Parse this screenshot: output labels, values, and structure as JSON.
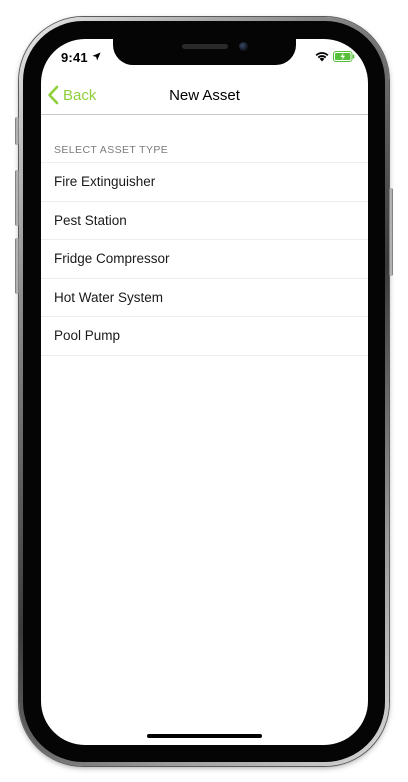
{
  "status_bar": {
    "time": "9:41",
    "icons": [
      "location-arrow-icon",
      "wifi-icon",
      "battery-charging-icon"
    ]
  },
  "navbar": {
    "back_label": "Back",
    "title": "New Asset",
    "back_icon": "chevron-left-icon"
  },
  "section": {
    "header": "SELECT ASSET TYPE",
    "items": [
      {
        "label": "Fire Extinguisher"
      },
      {
        "label": "Pest Station"
      },
      {
        "label": "Fridge Compressor"
      },
      {
        "label": "Hot Water System"
      },
      {
        "label": "Pool Pump"
      }
    ]
  },
  "colors": {
    "accent": "#8fcf3a",
    "battery": "#57c03a",
    "text": "#1a1a1a",
    "section_header": "#7b7b7b",
    "separator": "#ededed"
  }
}
